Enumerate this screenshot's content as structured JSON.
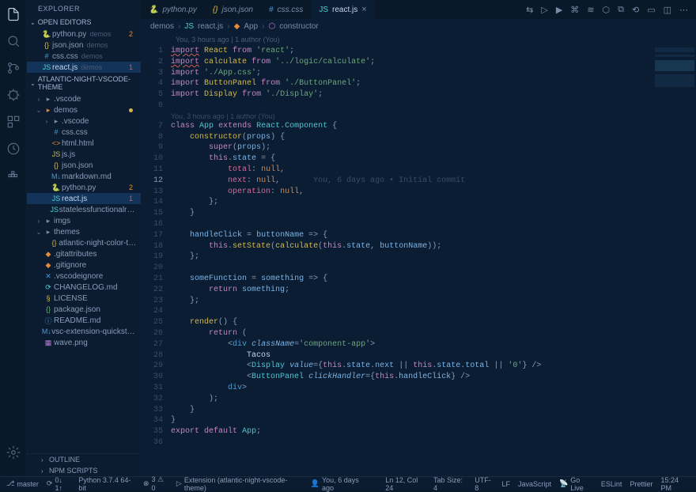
{
  "explorer": {
    "title": "EXPLORER",
    "open_editors_label": "OPEN EDITORS",
    "project_label": "ATLANTIC-NIGHT-VSCODE-THEME",
    "outline_label": "OUTLINE",
    "npm_scripts_label": "NPM SCRIPTS",
    "open_editors": [
      {
        "icon": "🐍",
        "iconClass": "blue",
        "name": "python.py",
        "suffix": "demos",
        "badge": "2",
        "badgeClass": "orange"
      },
      {
        "icon": "{}",
        "iconClass": "yellow",
        "name": "json.json",
        "suffix": "demos"
      },
      {
        "icon": "#",
        "iconClass": "blue",
        "name": "css.css",
        "suffix": "demos"
      },
      {
        "icon": "JS",
        "iconClass": "cyan",
        "name": "react.js",
        "suffix": "demos",
        "badge": "1",
        "badgeClass": "red",
        "selected": true
      }
    ],
    "tree": [
      {
        "depth": 0,
        "chev": "›",
        "icon": "▸",
        "iconClass": "gray",
        "name": ".vscode"
      },
      {
        "depth": 0,
        "chev": "⌄",
        "icon": "▸",
        "iconClass": "orange",
        "name": "demos",
        "dot": true
      },
      {
        "depth": 1,
        "chev": "›",
        "icon": "▸",
        "iconClass": "gray",
        "name": ".vscode"
      },
      {
        "depth": 1,
        "icon": "#",
        "iconClass": "blue",
        "name": "css.css"
      },
      {
        "depth": 1,
        "icon": "<>",
        "iconClass": "orange",
        "name": "html.html"
      },
      {
        "depth": 1,
        "icon": "JS",
        "iconClass": "yellow",
        "name": "js.js"
      },
      {
        "depth": 1,
        "icon": "{}",
        "iconClass": "yellow",
        "name": "json.json"
      },
      {
        "depth": 1,
        "icon": "M↓",
        "iconClass": "blue",
        "name": "markdown.md"
      },
      {
        "depth": 1,
        "icon": "🐍",
        "iconClass": "blue",
        "name": "python.py",
        "badge": "2",
        "badgeClass": "orange"
      },
      {
        "depth": 1,
        "icon": "JS",
        "iconClass": "cyan",
        "name": "react.js",
        "badge": "1",
        "badgeClass": "red",
        "selected": true
      },
      {
        "depth": 1,
        "icon": "JS",
        "iconClass": "cyan",
        "name": "statelessfunctionalreact.js"
      },
      {
        "depth": 0,
        "chev": "›",
        "icon": "▸",
        "iconClass": "gray",
        "name": "imgs"
      },
      {
        "depth": 0,
        "chev": "⌄",
        "icon": "▸",
        "iconClass": "gray",
        "name": "themes"
      },
      {
        "depth": 1,
        "icon": "{}",
        "iconClass": "yellow",
        "name": "atlantic-night-color-them…"
      },
      {
        "depth": 0,
        "icon": "◆",
        "iconClass": "orange",
        "name": ".gitattributes"
      },
      {
        "depth": 0,
        "icon": "◆",
        "iconClass": "orange",
        "name": ".gitignore"
      },
      {
        "depth": 0,
        "icon": "✕",
        "iconClass": "blue",
        "name": ".vscodeignore"
      },
      {
        "depth": 0,
        "icon": "⟳",
        "iconClass": "cyan",
        "name": "CHANGELOG.md"
      },
      {
        "depth": 0,
        "icon": "§",
        "iconClass": "yellow",
        "name": "LICENSE"
      },
      {
        "depth": 0,
        "icon": "{}",
        "iconClass": "green",
        "name": "package.json"
      },
      {
        "depth": 0,
        "icon": "ⓘ",
        "iconClass": "blue",
        "name": "README.md"
      },
      {
        "depth": 0,
        "icon": "M↓",
        "iconClass": "blue",
        "name": "vsc-extension-quickstart.md"
      },
      {
        "depth": 0,
        "icon": "▦",
        "iconClass": "purple",
        "name": "wave.png"
      }
    ]
  },
  "tabs": [
    {
      "icon": "🐍",
      "iconClass": "blue",
      "label": "python.py"
    },
    {
      "icon": "{}",
      "iconClass": "yellow",
      "label": "json.json"
    },
    {
      "icon": "#",
      "iconClass": "blue",
      "label": "css.css"
    },
    {
      "icon": "JS",
      "iconClass": "cyan",
      "label": "react.js",
      "active": true,
      "close": true
    }
  ],
  "breadcrumb": {
    "p1": "demos",
    "p2": "react.js",
    "p3": "App",
    "p4": "constructor"
  },
  "authorship": {
    "l1": "You, 3 hours ago | 1 author (You)",
    "l2": "You, 3 hours ago | 1 author (You)",
    "inline_blame": "You, 6 days ago • Initial commit"
  },
  "code": {
    "line_count": 36,
    "active_line": 12,
    "lines": [
      [
        [
          "kw",
          "import"
        ],
        [
          "",
          " "
        ],
        [
          "import",
          "React"
        ],
        [
          "",
          " "
        ],
        [
          "kw",
          "from"
        ],
        [
          "",
          " "
        ],
        [
          "str",
          "'react'"
        ],
        [
          "punct",
          ";"
        ]
      ],
      [
        [
          "kw",
          "import"
        ],
        [
          "",
          " "
        ],
        [
          "import",
          "calculate"
        ],
        [
          "",
          " "
        ],
        [
          "kw",
          "from"
        ],
        [
          "",
          " "
        ],
        [
          "str",
          "'../logic/calculate'"
        ],
        [
          "punct",
          ";"
        ]
      ],
      [
        [
          "kw",
          "import"
        ],
        [
          "",
          " "
        ],
        [
          "str",
          "'./App.css'"
        ],
        [
          "punct",
          ";"
        ]
      ],
      [
        [
          "kw",
          "import"
        ],
        [
          "",
          " "
        ],
        [
          "import",
          "ButtonPanel"
        ],
        [
          "",
          " "
        ],
        [
          "kw",
          "from"
        ],
        [
          "",
          " "
        ],
        [
          "str",
          "'./ButtonPanel'"
        ],
        [
          "punct",
          ";"
        ]
      ],
      [
        [
          "kw",
          "import"
        ],
        [
          "",
          " "
        ],
        [
          "import",
          "Display"
        ],
        [
          "",
          " "
        ],
        [
          "kw",
          "from"
        ],
        [
          "",
          " "
        ],
        [
          "str",
          "'./Display'"
        ],
        [
          "punct",
          ";"
        ]
      ],
      [],
      [
        [
          "kw",
          "class"
        ],
        [
          "",
          " "
        ],
        [
          "class",
          "App"
        ],
        [
          "",
          " "
        ],
        [
          "kw",
          "extends"
        ],
        [
          "",
          " "
        ],
        [
          "class",
          "React"
        ],
        [
          "punct",
          "."
        ],
        [
          "class",
          "Component"
        ],
        [
          "",
          " "
        ],
        [
          "punct",
          "{"
        ]
      ],
      [
        [
          "",
          "    "
        ],
        [
          "fn",
          "constructor"
        ],
        [
          "punct",
          "("
        ],
        [
          "var",
          "props"
        ],
        [
          "punct",
          ")"
        ],
        [
          "",
          " "
        ],
        [
          "punct",
          "{"
        ]
      ],
      [
        [
          "",
          "        "
        ],
        [
          "kw",
          "super"
        ],
        [
          "punct",
          "("
        ],
        [
          "var",
          "props"
        ],
        [
          "punct",
          ")"
        ],
        [
          "punct",
          ";"
        ]
      ],
      [
        [
          "",
          "        "
        ],
        [
          "kw",
          "this"
        ],
        [
          "punct",
          "."
        ],
        [
          "var",
          "state"
        ],
        [
          "",
          " "
        ],
        [
          "punct",
          "="
        ],
        [
          "",
          " "
        ],
        [
          "punct",
          "{"
        ]
      ],
      [
        [
          "",
          "            "
        ],
        [
          "prop",
          "total"
        ],
        [
          "punct",
          ":"
        ],
        [
          "",
          " "
        ],
        [
          "const",
          "null"
        ],
        [
          "punct",
          ","
        ]
      ],
      [
        [
          "",
          "            "
        ],
        [
          "prop",
          "next"
        ],
        [
          "punct",
          ":"
        ],
        [
          "",
          " "
        ],
        [
          "const",
          "null"
        ],
        [
          "punct",
          ","
        ],
        [
          "",
          "       "
        ],
        [
          "hint",
          "You, 6 days ago • Initial commit"
        ]
      ],
      [
        [
          "",
          "            "
        ],
        [
          "prop",
          "operation"
        ],
        [
          "punct",
          ":"
        ],
        [
          "",
          " "
        ],
        [
          "const",
          "null"
        ],
        [
          "punct",
          ","
        ]
      ],
      [
        [
          "",
          "        "
        ],
        [
          "punct",
          "};"
        ]
      ],
      [
        [
          "",
          "    "
        ],
        [
          "punct",
          "}"
        ]
      ],
      [],
      [
        [
          "",
          "    "
        ],
        [
          "var",
          "handleClick"
        ],
        [
          "",
          " "
        ],
        [
          "punct",
          "="
        ],
        [
          "",
          " "
        ],
        [
          "var",
          "buttonName"
        ],
        [
          "",
          " "
        ],
        [
          "punct",
          "=>"
        ],
        [
          "",
          " "
        ],
        [
          "punct",
          "{"
        ]
      ],
      [
        [
          "",
          "        "
        ],
        [
          "kw",
          "this"
        ],
        [
          "punct",
          "."
        ],
        [
          "fn",
          "setState"
        ],
        [
          "punct",
          "("
        ],
        [
          "fn",
          "calculate"
        ],
        [
          "punct",
          "("
        ],
        [
          "kw",
          "this"
        ],
        [
          "punct",
          "."
        ],
        [
          "var",
          "state"
        ],
        [
          "punct",
          ","
        ],
        [
          "",
          " "
        ],
        [
          "var",
          "buttonName"
        ],
        [
          "punct",
          "))"
        ],
        [
          "punct",
          ";"
        ]
      ],
      [
        [
          "",
          "    "
        ],
        [
          "punct",
          "};"
        ]
      ],
      [],
      [
        [
          "",
          "    "
        ],
        [
          "var",
          "someFunction"
        ],
        [
          "",
          " "
        ],
        [
          "punct",
          "="
        ],
        [
          "",
          " "
        ],
        [
          "var",
          "something"
        ],
        [
          "",
          " "
        ],
        [
          "punct",
          "=>"
        ],
        [
          "",
          " "
        ],
        [
          "punct",
          "{"
        ]
      ],
      [
        [
          "",
          "        "
        ],
        [
          "kw",
          "return"
        ],
        [
          "",
          " "
        ],
        [
          "var",
          "something"
        ],
        [
          "punct",
          ";"
        ]
      ],
      [
        [
          "",
          "    "
        ],
        [
          "punct",
          "};"
        ]
      ],
      [],
      [
        [
          "",
          "    "
        ],
        [
          "fn",
          "render"
        ],
        [
          "punct",
          "()"
        ],
        [
          "",
          " "
        ],
        [
          "punct",
          "{"
        ]
      ],
      [
        [
          "",
          "        "
        ],
        [
          "kw",
          "return"
        ],
        [
          "",
          " "
        ],
        [
          "punct",
          "("
        ]
      ],
      [
        [
          "",
          "            "
        ],
        [
          "punct",
          "<"
        ],
        [
          "tag",
          "div"
        ],
        [
          "",
          " "
        ],
        [
          "attr",
          "className"
        ],
        [
          "punct",
          "="
        ],
        [
          "str",
          "'component-app'"
        ],
        [
          "punct",
          ">"
        ]
      ],
      [
        [
          "",
          "                "
        ],
        [
          "",
          "Tacos"
        ]
      ],
      [
        [
          "",
          "                "
        ],
        [
          "punct",
          "<"
        ],
        [
          "class",
          "Display"
        ],
        [
          "",
          " "
        ],
        [
          "attr",
          "value"
        ],
        [
          "punct",
          "={"
        ],
        [
          "kw",
          "this"
        ],
        [
          "punct",
          "."
        ],
        [
          "var",
          "state"
        ],
        [
          "punct",
          "."
        ],
        [
          "var",
          "next"
        ],
        [
          "",
          " "
        ],
        [
          "punct",
          "||"
        ],
        [
          "",
          " "
        ],
        [
          "kw",
          "this"
        ],
        [
          "punct",
          "."
        ],
        [
          "var",
          "state"
        ],
        [
          "punct",
          "."
        ],
        [
          "var",
          "total"
        ],
        [
          "",
          " "
        ],
        [
          "punct",
          "||"
        ],
        [
          "",
          " "
        ],
        [
          "str",
          "'0'"
        ],
        [
          "punct",
          "}"
        ],
        [
          "",
          " "
        ],
        [
          "punct",
          "/>"
        ]
      ],
      [
        [
          "",
          "                "
        ],
        [
          "punct",
          "<"
        ],
        [
          "class",
          "ButtonPanel"
        ],
        [
          "",
          " "
        ],
        [
          "attr",
          "clickHandler"
        ],
        [
          "punct",
          "={"
        ],
        [
          "kw",
          "this"
        ],
        [
          "punct",
          "."
        ],
        [
          "var",
          "handleClick"
        ],
        [
          "punct",
          "}"
        ],
        [
          "",
          " "
        ],
        [
          "punct",
          "/>"
        ]
      ],
      [
        [
          "",
          "            "
        ],
        [
          "punct",
          "</"
        ],
        [
          "tag",
          "div"
        ],
        [
          "punct",
          ">"
        ]
      ],
      [
        [
          "",
          "        "
        ],
        [
          "punct",
          ");"
        ]
      ],
      [
        [
          "",
          "    "
        ],
        [
          "punct",
          "}"
        ]
      ],
      [
        [
          "punct",
          "}"
        ]
      ],
      [
        [
          "kw",
          "export"
        ],
        [
          "",
          " "
        ],
        [
          "kw",
          "default"
        ],
        [
          "",
          " "
        ],
        [
          "class",
          "App"
        ],
        [
          "punct",
          ";"
        ]
      ],
      []
    ]
  },
  "status": {
    "branch": "master",
    "sync": "0↓ 1↑",
    "python": "Python 3.7.4 64-bit",
    "problems": "3 ⚠ 0",
    "extension": "Extension (atlantic-night-vscode-theme)",
    "blame": "You, 6 days ago",
    "position": "Ln 12, Col 24",
    "tabsize": "Tab Size: 4",
    "encoding": "UTF-8",
    "eol": "LF",
    "language": "JavaScript",
    "golive": "Go Live",
    "eslint": "ESLint",
    "prettier": "Prettier",
    "time": "15:24 PM"
  }
}
